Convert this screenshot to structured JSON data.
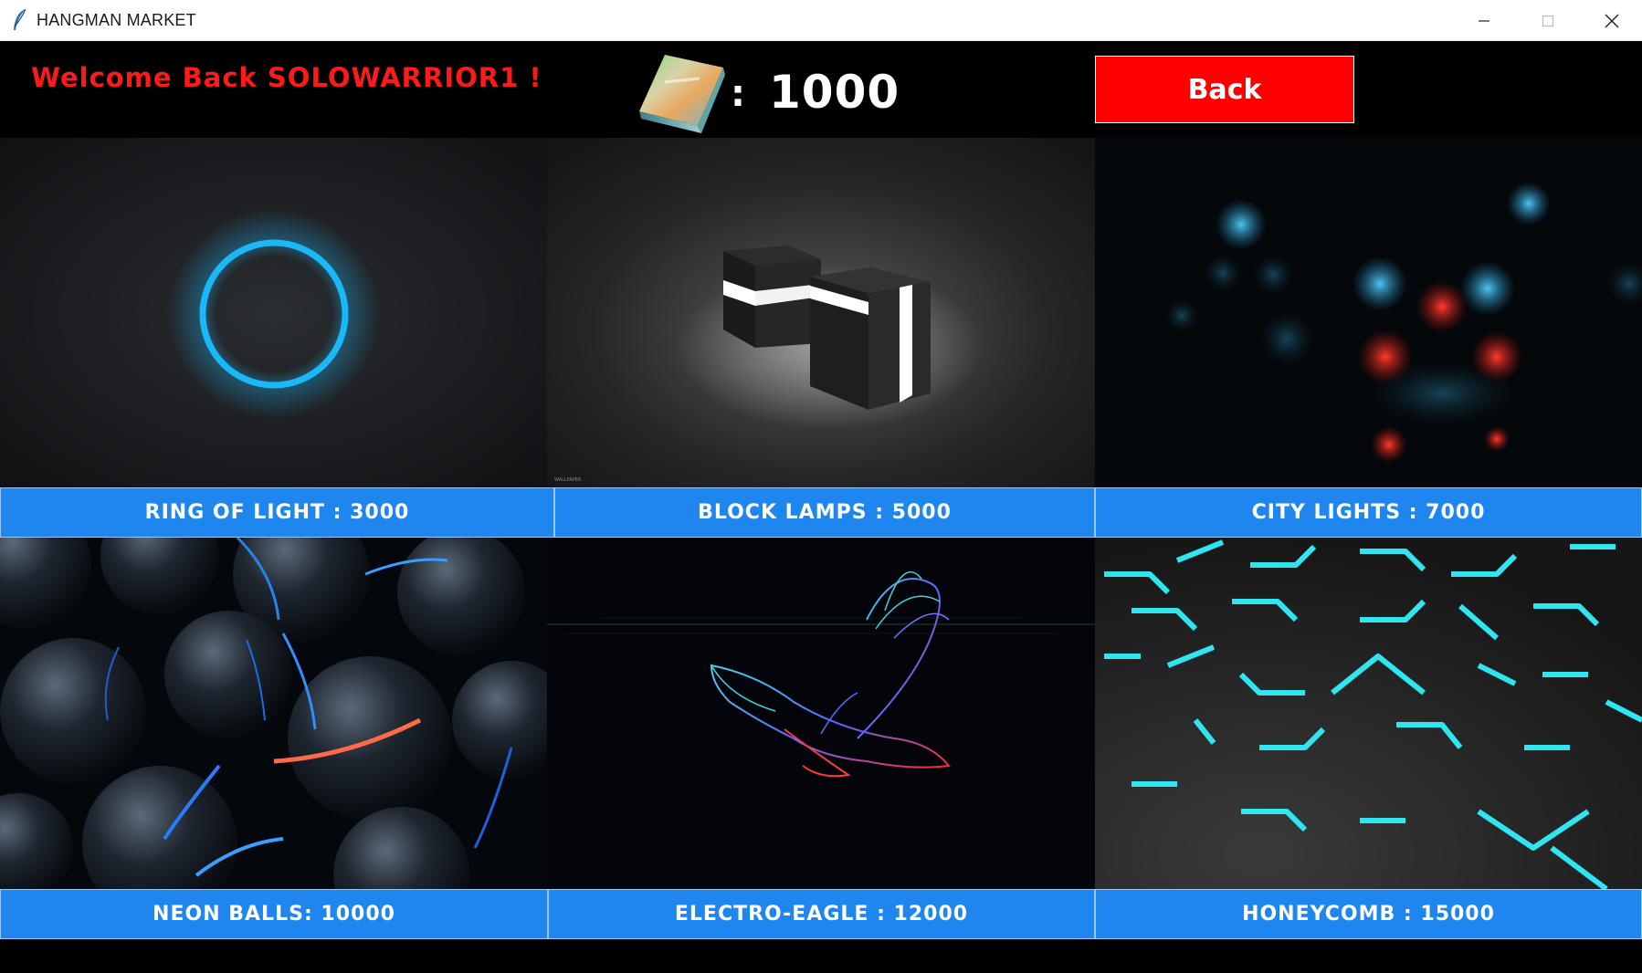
{
  "window": {
    "title": "HANGMAN MARKET",
    "app_icon": "feather-icon",
    "controls": [
      "minimize-icon",
      "maximize-icon",
      "close-icon"
    ]
  },
  "header": {
    "welcome_text": "Welcome Back SOLOWARRIOR1 !",
    "currency_icon": "gem-bar-icon",
    "currency_separator": ":",
    "currency_amount": "1000",
    "back_label": "Back"
  },
  "market": {
    "items": [
      {
        "label": "RING OF LIGHT : 3000",
        "thumbnail": "ring-of-light-wallpaper"
      },
      {
        "label": "BLOCK LAMPS : 5000",
        "thumbnail": "block-lamps-wallpaper"
      },
      {
        "label": "CITY LIGHTS : 7000",
        "thumbnail": "city-lights-wallpaper"
      },
      {
        "label": "NEON BALLS: 10000",
        "thumbnail": "neon-balls-wallpaper"
      },
      {
        "label": "ELECTRO-EAGLE : 12000",
        "thumbnail": "electro-eagle-wallpaper"
      },
      {
        "label": "HONEYCOMB : 15000",
        "thumbnail": "honeycomb-wallpaper"
      }
    ]
  },
  "colors": {
    "background": "#000000",
    "welcome_text": "#ff1a1a",
    "back_button": "#ff0000",
    "label_bar": "#1e86ee",
    "label_text": "#ffffff",
    "ring_glow": "#18b4f5",
    "honeycomb_glow": "#28e8f0"
  }
}
